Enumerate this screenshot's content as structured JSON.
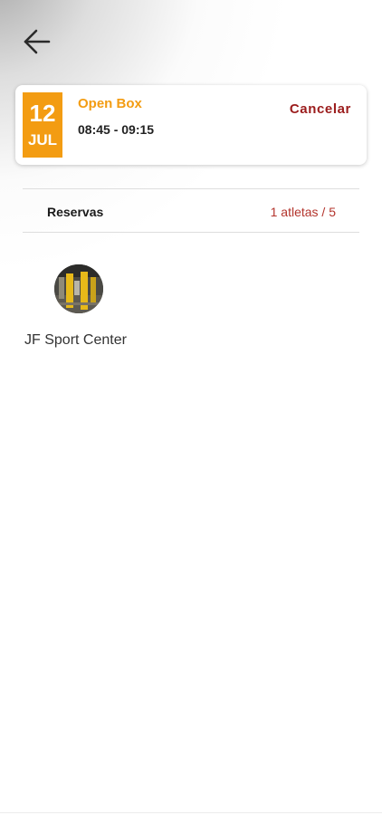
{
  "header": {
    "back_icon": "arrow-left-icon"
  },
  "class_card": {
    "day": "12",
    "month": "JUL",
    "name": "Open Box",
    "time": "08:45 - 09:15",
    "cancel_label": "Cancelar",
    "accent_color": "#f39c12",
    "cancel_color": "#9b1c1c"
  },
  "reservations": {
    "label": "Reservas",
    "count": "1 atletas / 5",
    "count_color": "#b3342c"
  },
  "athletes": [
    {
      "name": "JF Sport Center",
      "avatar_icon": "gym-photo-avatar"
    }
  ]
}
